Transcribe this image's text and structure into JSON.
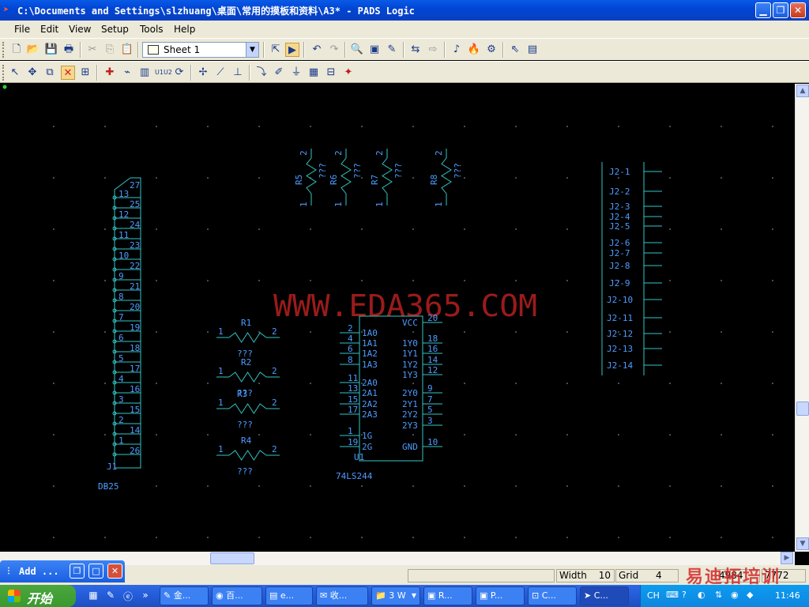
{
  "window": {
    "title": "C:\\Documents and Settings\\slzhuang\\桌面\\常用的摸板和资料\\A3* - PADS Logic"
  },
  "menu": [
    "File",
    "Edit",
    "View",
    "Setup",
    "Tools",
    "Help"
  ],
  "toolbar": {
    "sheet_value": "Sheet 1"
  },
  "schematic": {
    "watermark": "WWW.EDA365.COM",
    "resistors_top": [
      {
        "ref": "R5",
        "val": "???",
        "p1": "1",
        "p2": "2"
      },
      {
        "ref": "R6",
        "val": "???",
        "p1": "1",
        "p2": "2"
      },
      {
        "ref": "R7",
        "val": "???",
        "p1": "1",
        "p2": "2"
      },
      {
        "ref": "R8",
        "val": "???",
        "p1": "1",
        "p2": "2"
      }
    ],
    "resistors_left": [
      {
        "ref": "R1",
        "val": "???",
        "p1": "1",
        "p2": "2"
      },
      {
        "ref": "R2",
        "val": "???",
        "p1": "1",
        "p2": "2"
      },
      {
        "ref": "R3",
        "val": "???",
        "p1": "1",
        "p2": "2"
      },
      {
        "ref": "R4",
        "val": "???",
        "p1": "1",
        "p2": "2"
      }
    ],
    "db25": {
      "ref": "J1",
      "part": "DB25",
      "pins": [
        "13",
        "25",
        "12",
        "24",
        "11",
        "23",
        "10",
        "22",
        "9",
        "21",
        "8",
        "20",
        "7",
        "19",
        "6",
        "18",
        "5",
        "17",
        "4",
        "16",
        "3",
        "15",
        "2",
        "14",
        "1",
        "26"
      ],
      "top_pin": "27"
    },
    "ic": {
      "ref": "U1",
      "part": "74LS244",
      "left_pins": [
        {
          "num": "2",
          "name": "1A0"
        },
        {
          "num": "4",
          "name": "1A1"
        },
        {
          "num": "6",
          "name": "1A2"
        },
        {
          "num": "8",
          "name": "1A3"
        },
        {
          "num": "11",
          "name": "2A0"
        },
        {
          "num": "13",
          "name": "2A1"
        },
        {
          "num": "15",
          "name": "2A2"
        },
        {
          "num": "17",
          "name": "2A3"
        },
        {
          "num": "1",
          "name": "1G"
        },
        {
          "num": "19",
          "name": "2G"
        }
      ],
      "right_pins": [
        {
          "num": "20",
          "name": "VCC"
        },
        {
          "num": "18",
          "name": "1Y0"
        },
        {
          "num": "16",
          "name": "1Y1"
        },
        {
          "num": "14",
          "name": "1Y2"
        },
        {
          "num": "12",
          "name": "1Y3"
        },
        {
          "num": "9",
          "name": "2Y0"
        },
        {
          "num": "7",
          "name": "2Y1"
        },
        {
          "num": "5",
          "name": "2Y2"
        },
        {
          "num": "3",
          "name": "2Y3"
        },
        {
          "num": "10",
          "name": "GND"
        }
      ]
    },
    "j2": [
      "J2-1",
      "J2-2",
      "J2-3",
      "J2-4",
      "J2-5",
      "J2-6",
      "J2-7",
      "J2-8",
      "J2-9",
      "J2-10",
      "J2-11",
      "J2-12",
      "J2-13",
      "J2-14"
    ]
  },
  "addpanel": {
    "label": "Add ..."
  },
  "status": {
    "width_label": "Width",
    "width_value": "10",
    "grid_label": "Grid",
    "grid_value": "4",
    "x": "4984",
    "y": "7772"
  },
  "overlay_watermark": "易迪拓培训",
  "taskbar": {
    "start": "开始",
    "tasks": [
      "金...",
      "百...",
      "e...",
      "收...",
      "3 W",
      "R...",
      "P...",
      "C...",
      "C..."
    ],
    "lang": "CH",
    "clock": "11:46"
  },
  "colors": {
    "wire": "#33c6c6",
    "text": "#4d9cff",
    "watermark": "#9b1b1b"
  }
}
